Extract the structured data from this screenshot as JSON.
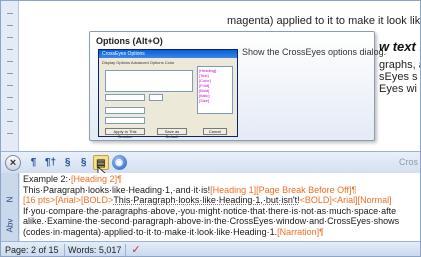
{
  "document": {
    "line1": "magenta) applied to it to make it look like Heading",
    "heading_fragment": "w text l",
    "para_lines": [
      "graphs, a",
      "sEyes s",
      "Eyes wi"
    ]
  },
  "tooltip": {
    "title": "Options (Alt+O)",
    "description": "Show the CrossEyes options dialog.",
    "mini_dialog_title": "CrossEyes Options",
    "mini_dialog_tabs": "Display Options   Advanced Options   Color",
    "mini_buttons": [
      "Apply to This Session",
      "Save as Default",
      "Cancel"
    ]
  },
  "toolbar": {
    "close_icon": "×",
    "buttons": [
      "¶",
      "¶†",
      "§",
      "§",
      "▤",
      "◉"
    ],
    "panel_title": "Cros"
  },
  "vertical_tabs": [
    "N",
    "Abv"
  ],
  "content": {
    "lines": [
      [
        {
          "t": "Example 2:·",
          "c": ""
        },
        {
          "t": "[Heading 2]¶",
          "c": "code"
        }
      ],
      [
        {
          "t": "This·Paragraph·looks·like·Heading·1,·and·it·is!",
          "c": ""
        },
        {
          "t": "[Heading 1][Page Break Before Off]¶",
          "c": "code"
        }
      ],
      [
        {
          "t": "[16 pts>[Arial>[BOLD>",
          "c": "code"
        },
        {
          "t": "This·Paragraph·looks·like·Heading·1,·but·isn't!",
          "c": "dotted"
        },
        {
          "t": "<BOLD]<Arial][Normal]",
          "c": "code"
        }
      ],
      [
        {
          "t": "If·you·compare·the·paragraphs·above,·you·might·notice·that·there·is·not·as·much·space·afte",
          "c": ""
        }
      ],
      [
        {
          "t": "alike.·Examine·the·second·paragraph·above·in·the·CrossEyes·window·and·CrossEyes·shows",
          "c": ""
        }
      ],
      [
        {
          "t": "(codes·in·magenta)·applied·to·it·to·make·it·look·like·Heading·1.",
          "c": ""
        },
        {
          "t": "[Narration]¶",
          "c": "code"
        }
      ]
    ]
  },
  "status_bar": {
    "page": "Page: 2 of 15",
    "words": "Words: 5,017",
    "spell_icon": "spell-check-icon"
  }
}
